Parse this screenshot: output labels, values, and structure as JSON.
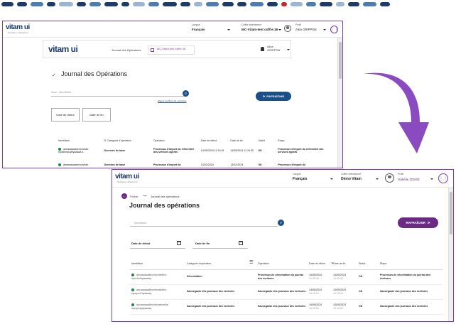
{
  "colors": {
    "brand_purple": "#7b3fa8",
    "brand_navy": "#1b3b6f",
    "refresh_blue": "#1b4f8a",
    "refresh_purple": "#6b2a83",
    "ok_green": "#1f8a3a"
  },
  "top_dashes": [
    "#1b3b6f",
    "#1b3b6f",
    "#4a7db5",
    "#1b3b6f",
    "#9bb5d6",
    "#1b3b6f",
    "#4a7db5",
    "#1b3b6f",
    "#1b3b6f",
    "#9bb5d6",
    "#4a7db5",
    "#1b3b6f",
    "#1b3b6f",
    "#9bb5d6",
    "#4a7db5",
    "#1b3b6f",
    "#1b3b6f",
    "#4a7db5",
    "#1b3b6f",
    "#c62828",
    "#9bb5d6",
    "#4a7db5",
    "#1b3b6f",
    "#9bb5d6",
    "#1b3b6f",
    "#4a7db5",
    "#1b3b6f"
  ],
  "old_window": {
    "logo": "vitam ui",
    "logo_sub": "Interfaces utilisateurs",
    "langue_label": "Langue",
    "langue_value": "Français",
    "coffre_label": "Coffre sélectionné",
    "coffre_value": "MC-Vitam-test coffre 36",
    "profil_label": "Profil",
    "profil_value": "Alice GRIPPON",
    "app_title": "Journal des Opérations",
    "tenant_chip": "MC-Vitam-test coffre 36",
    "user_name": "Alice GRIPPON",
    "heading": "Journal des Opérations",
    "search_placeholder": "Nom, Identifiant",
    "clear_link": "Effacer les filtres de recherche",
    "refresh_label": "RAFRAÎCHIR",
    "date_start": "Date de début",
    "date_end": "Date de fin",
    "columns": [
      "Identifiant",
      "Catégorie d'opération",
      "Opération",
      "Date de début",
      "Date de fin",
      "Statut",
      "Étape"
    ],
    "rows": [
      {
        "id": "aeeaaaaaaeeccechab myaampcqefyaaaaa a",
        "category": "Données de base",
        "operation": "Processus d'import du référentiel des services agents",
        "start": "14/05/2024 11:19:34",
        "end": "14/05/2024 11:19:35",
        "status": "OK",
        "step": "Processus d'import du référentiel des services agents"
      },
      {
        "id": "aeeaaaaaaeeccechab",
        "category": "Données de base",
        "operation": "Processus d'import du",
        "start": "13/02/2024",
        "end": "13/02/2024",
        "status": "OK",
        "step": "Processus d'import du"
      }
    ]
  },
  "new_window": {
    "logo": "vitam ui",
    "logo_sub": "Interfaces utilisateurs",
    "langue_label": "Langue",
    "langue_value": "Français",
    "coffre_label": "Coffre sélectionné",
    "coffre_value": "Démo Vitam",
    "profil_label": "Profil",
    "profil_value": "Isabelle JOSSE",
    "breadcrumb_home": "Portail",
    "breadcrumb_current": "Journal des opérations",
    "heading": "Journal des opérations",
    "search_placeholder": "Identifiant",
    "refresh_label": "RAFRAÎCHIR",
    "date_start": "Date de début",
    "date_end": "Date de fin",
    "columns": [
      "Identifiant",
      "Catégorie d'opération",
      "Opération",
      "Date de début",
      "Date de fin",
      "Statut",
      "Étape"
    ],
    "rows": [
      {
        "id": "aecaaaaaa6ecmeurabilmo mpiu3o3qaaaaaq",
        "category": "Sécurisation",
        "operation": "Processus de sécurisation du journal des écritures",
        "start_date": "14/05/2024",
        "start_time": "10:40:00",
        "end_date": "14/05/2024",
        "end_time": "10:40:00",
        "status": "OK",
        "step": "Processus de sécurisation du journal des écritures"
      },
      {
        "id": "aecaaaaaa6ecmeurabilmo mpoyvu7ayaaaaq",
        "category": "Sauvegarde des journaux des écritures",
        "operation": "Sauvegarde des journaux des écritures",
        "start_date": "14/05/2024",
        "start_time": "10:15:01",
        "end_date": "14/05/2024",
        "end_time": "10:15:01",
        "status": "OK",
        "step": "Sauvegarde des journaux des écritures"
      },
      {
        "id": "aecaaaaaa6ecmeurabmc6a mpoyvuyayaaaaq",
        "category": "Sauvegarde des journaux des écritures",
        "operation": "Sauvegarde des journaux des écritures",
        "start_date": "14/05/2024",
        "start_time": "10:15:00",
        "end_date": "14/05/2024",
        "end_time": "10:15:00",
        "status": "OK",
        "step": "Sauvegarde des journaux des écritures"
      }
    ]
  }
}
